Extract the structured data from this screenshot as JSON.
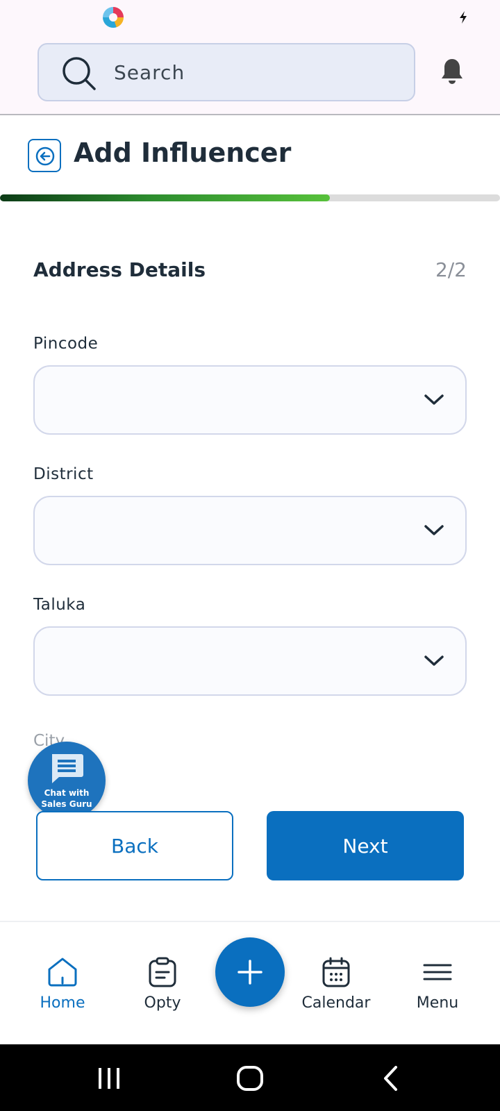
{
  "header": {
    "search_placeholder": "Search"
  },
  "page": {
    "title": "Add Influencer",
    "progress": 0.66
  },
  "section": {
    "title": "Address Details",
    "step": "2/2"
  },
  "fields": [
    {
      "label": "Pincode",
      "value": ""
    },
    {
      "label": "District",
      "value": ""
    },
    {
      "label": "Taluka",
      "value": ""
    },
    {
      "label": "City"
    }
  ],
  "chat": {
    "line1": "Chat with",
    "line2": "Sales Guru"
  },
  "actions": {
    "back_label": "Back",
    "next_label": "Next"
  },
  "bottom_nav": {
    "items": [
      {
        "label": "Home",
        "icon": "home-icon",
        "active": true
      },
      {
        "label": "Opty",
        "icon": "clipboard-icon",
        "active": false
      },
      {
        "label": "Calendar",
        "icon": "calendar-icon",
        "active": false
      },
      {
        "label": "Menu",
        "icon": "hamburger-icon",
        "active": false
      }
    ]
  },
  "colors": {
    "primary": "#0a6fbf",
    "progress_start": "#0c3b16",
    "progress_end": "#57c13b"
  }
}
